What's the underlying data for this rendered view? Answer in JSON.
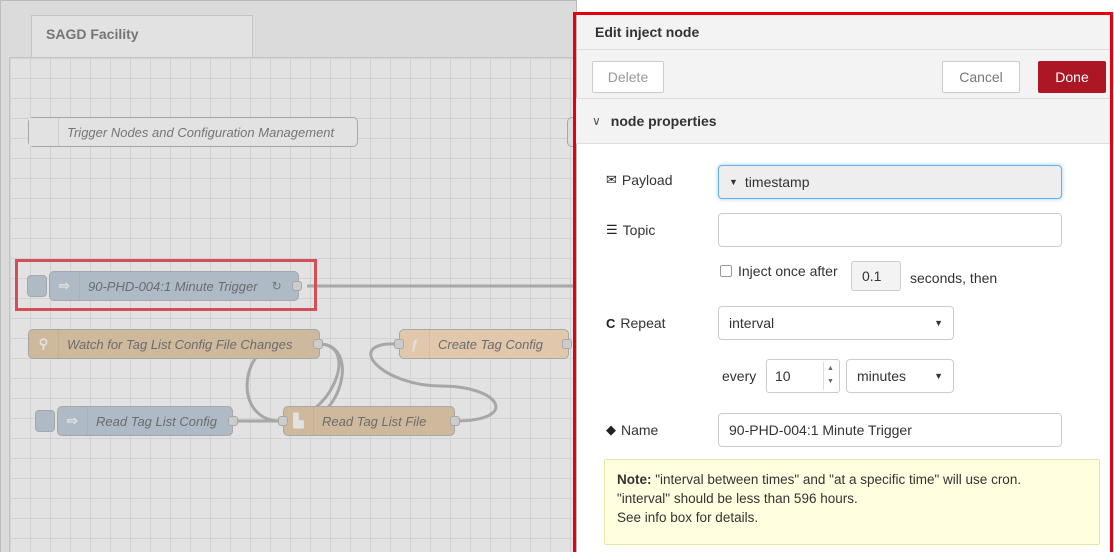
{
  "workspace": {
    "tab_label": "SAGD Facility",
    "comment_label": "Trigger Nodes and Configuration Management",
    "nodes": {
      "inject_trigger": "90-PHD-004:1 Minute Trigger",
      "repeat_glyph": "↻",
      "watch": "Watch for Tag List Config File Changes",
      "create": "Create Tag Config",
      "read_config": "Read Tag List Config",
      "read_file": "Read Tag List File"
    },
    "colors": {
      "inject": "#a6bbcf",
      "watch": "#deb887",
      "function": "#fdd0a2",
      "file": "#deb887"
    }
  },
  "tray": {
    "title": "Edit inject node",
    "delete_label": "Delete",
    "cancel_label": "Cancel",
    "done_label": "Done",
    "section_label": "node properties",
    "payload": {
      "label": "Payload",
      "icon": "envelope-icon",
      "value": "timestamp"
    },
    "topic": {
      "label": "Topic",
      "icon": "tasks-icon",
      "value": ""
    },
    "inject_once": {
      "label": "Inject once after",
      "value": "0.1",
      "suffix": "seconds, then",
      "checked": false
    },
    "repeat": {
      "label": "Repeat",
      "icon": "repeat-icon",
      "value": "interval"
    },
    "every": {
      "label": "every",
      "value": "10",
      "unit": "minutes"
    },
    "name": {
      "label": "Name",
      "icon": "tag-icon",
      "value": "90-PHD-004:1 Minute Trigger"
    },
    "note": {
      "bold": "Note:",
      "line1": " \"interval between times\" and \"at a specific time\" will use cron.",
      "line2": "\"interval\" should be less than 596 hours.",
      "line3": "See info box for details."
    },
    "accent_color": "#ad1625"
  }
}
